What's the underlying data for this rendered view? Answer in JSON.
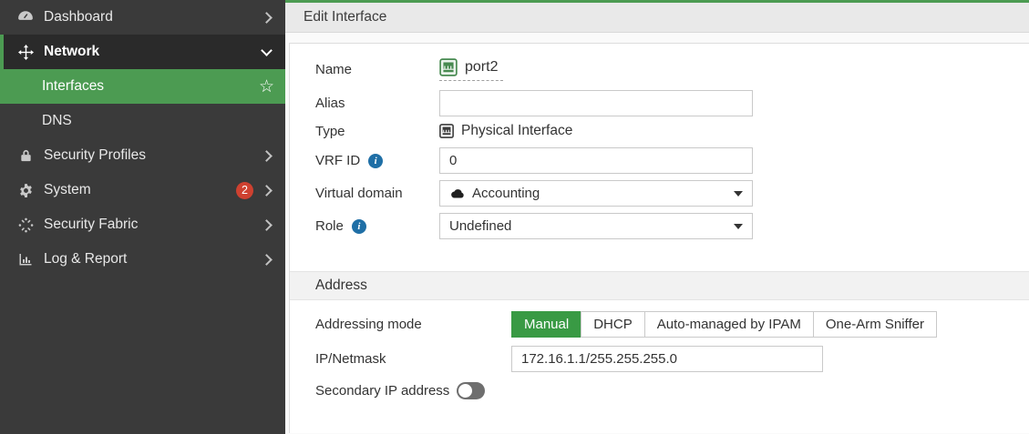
{
  "colors": {
    "accent_green": "#4c9b52",
    "selected_green": "#399a44",
    "badge_red": "#ce4130",
    "info_blue": "#1f6fa6",
    "sidebar_bg": "#3a3a3a"
  },
  "sidebar": {
    "items": [
      {
        "label": "Dashboard",
        "icon": "gauge-icon",
        "chevron": "right"
      },
      {
        "label": "Network",
        "icon": "move-icon",
        "chevron": "down",
        "state": "expanded"
      },
      {
        "label": "Interfaces",
        "type": "sub-item",
        "selected": true,
        "icon": "star-icon",
        "star": "☆"
      },
      {
        "label": "DNS",
        "type": "sub-item"
      },
      {
        "label": "Security Profiles",
        "icon": "lock-icon",
        "chevron": "right"
      },
      {
        "label": "System",
        "icon": "gear-icon",
        "chevron": "right",
        "badge": "2"
      },
      {
        "label": "Security Fabric",
        "icon": "fabric-icon",
        "chevron": "right"
      },
      {
        "label": "Log & Report",
        "icon": "bar-chart-icon",
        "chevron": "right"
      }
    ]
  },
  "header": {
    "title": "Edit Interface"
  },
  "form": {
    "name": {
      "label": "Name",
      "value": "port2",
      "icon": "ethernet-port-icon"
    },
    "alias": {
      "label": "Alias",
      "value": ""
    },
    "type": {
      "label": "Type",
      "value": "Physical Interface",
      "icon": "ethernet-port-icon"
    },
    "vrf": {
      "label": "VRF ID",
      "value": "0",
      "info": "i"
    },
    "vdom": {
      "label": "Virtual domain",
      "value": "Accounting",
      "icon": "cloud-icon"
    },
    "role": {
      "label": "Role",
      "value": "Undefined",
      "info": "i"
    },
    "address_section": {
      "title": "Address"
    },
    "addressing_mode": {
      "label": "Addressing mode",
      "options": [
        "Manual",
        "DHCP",
        "Auto-managed by IPAM",
        "One-Arm Sniffer"
      ],
      "selected": "Manual"
    },
    "ip": {
      "label": "IP/Netmask",
      "value": "172.16.1.1/255.255.255.0"
    },
    "secondary": {
      "label": "Secondary IP address",
      "state": "off"
    }
  }
}
